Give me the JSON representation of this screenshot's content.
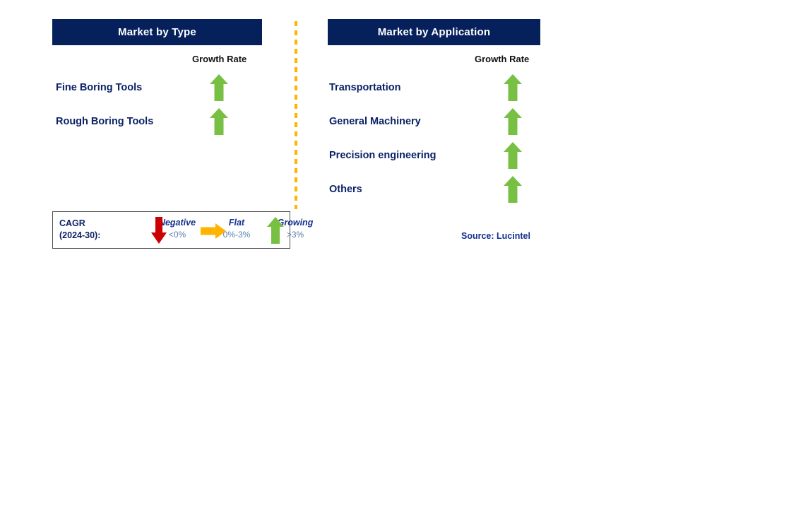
{
  "colors": {
    "header_bg": "#06205c",
    "header_text": "#ffffff",
    "label_navy": "#0b2265",
    "legend_navy": "#16308f",
    "legend_range": "#5b7fae",
    "arrow_green": "#78c044",
    "arrow_red": "#cc0000",
    "arrow_orange": "#ffb400",
    "divider_orange": "#ffb400",
    "legend_border": "#4d4d4d",
    "page_bg": "#ffffff"
  },
  "panels": [
    {
      "id": "market-by-type",
      "title": "Market by Type",
      "growth_rate_header": "Growth Rate",
      "rows": [
        {
          "label": "Fine Boring Tools",
          "growth": "growing",
          "arrow": "arrow-up-icon"
        },
        {
          "label": "Rough Boring Tools",
          "growth": "growing",
          "arrow": "arrow-up-icon"
        }
      ]
    },
    {
      "id": "market-by-application",
      "title": "Market by Application",
      "growth_rate_header": "Growth Rate",
      "rows": [
        {
          "label": "Transportation",
          "growth": "growing",
          "arrow": "arrow-up-icon"
        },
        {
          "label": "General Machinery",
          "growth": "growing",
          "arrow": "arrow-up-icon"
        },
        {
          "label": "Precision engineering",
          "growth": "growing",
          "arrow": "arrow-up-icon"
        },
        {
          "label": "Others",
          "growth": "growing",
          "arrow": "arrow-up-icon"
        }
      ]
    }
  ],
  "legend": {
    "title_line1": "CAGR",
    "title_line2": "(2024-30):",
    "items": [
      {
        "word": "Negative",
        "range": "<0%",
        "arrow": "arrow-down-icon",
        "color": "#cc0000"
      },
      {
        "word": "Flat",
        "range": "0%-3%",
        "arrow": "arrow-right-icon",
        "color": "#ffb400"
      },
      {
        "word": "Growing",
        "range": ">3%",
        "arrow": "arrow-up-icon",
        "color": "#78c044"
      }
    ]
  },
  "source": "Source: Lucintel"
}
